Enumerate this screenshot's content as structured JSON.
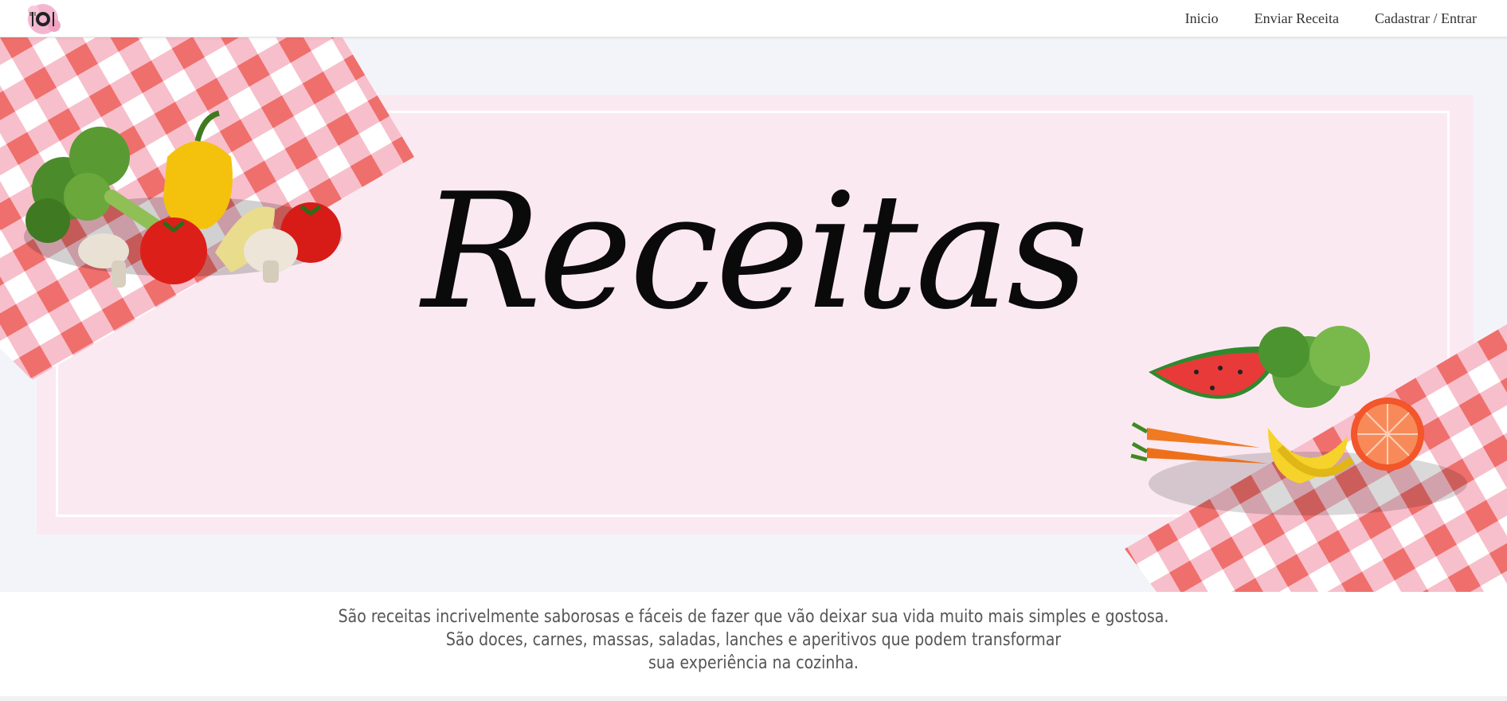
{
  "navbar": {
    "logo_icon": "plate-fork-knife-icon",
    "links": [
      {
        "label": "Inicio"
      },
      {
        "label": "Enviar Receita"
      },
      {
        "label": "Cadastrar / Entrar"
      }
    ]
  },
  "hero": {
    "title": "Receitas",
    "decor_left": "vegetables-on-checkered-cloth",
    "decor_right": "fruits-on-checkered-cloth"
  },
  "description": {
    "lines": [
      "São receitas incrivelmente saborosas e fáceis de fazer que vão deixar sua vida muito mais simples e gostosa.",
      "São doces, carnes, massas, saladas, lanches e aperitivos que podem transformar",
      "sua experiência na cozinha."
    ]
  },
  "colors": {
    "hero_bg": "#f3f4f9",
    "panel_pink": "#fbe9f2",
    "cloth_red": "#ef6f6c",
    "cloth_pink": "#f7b8c6"
  }
}
